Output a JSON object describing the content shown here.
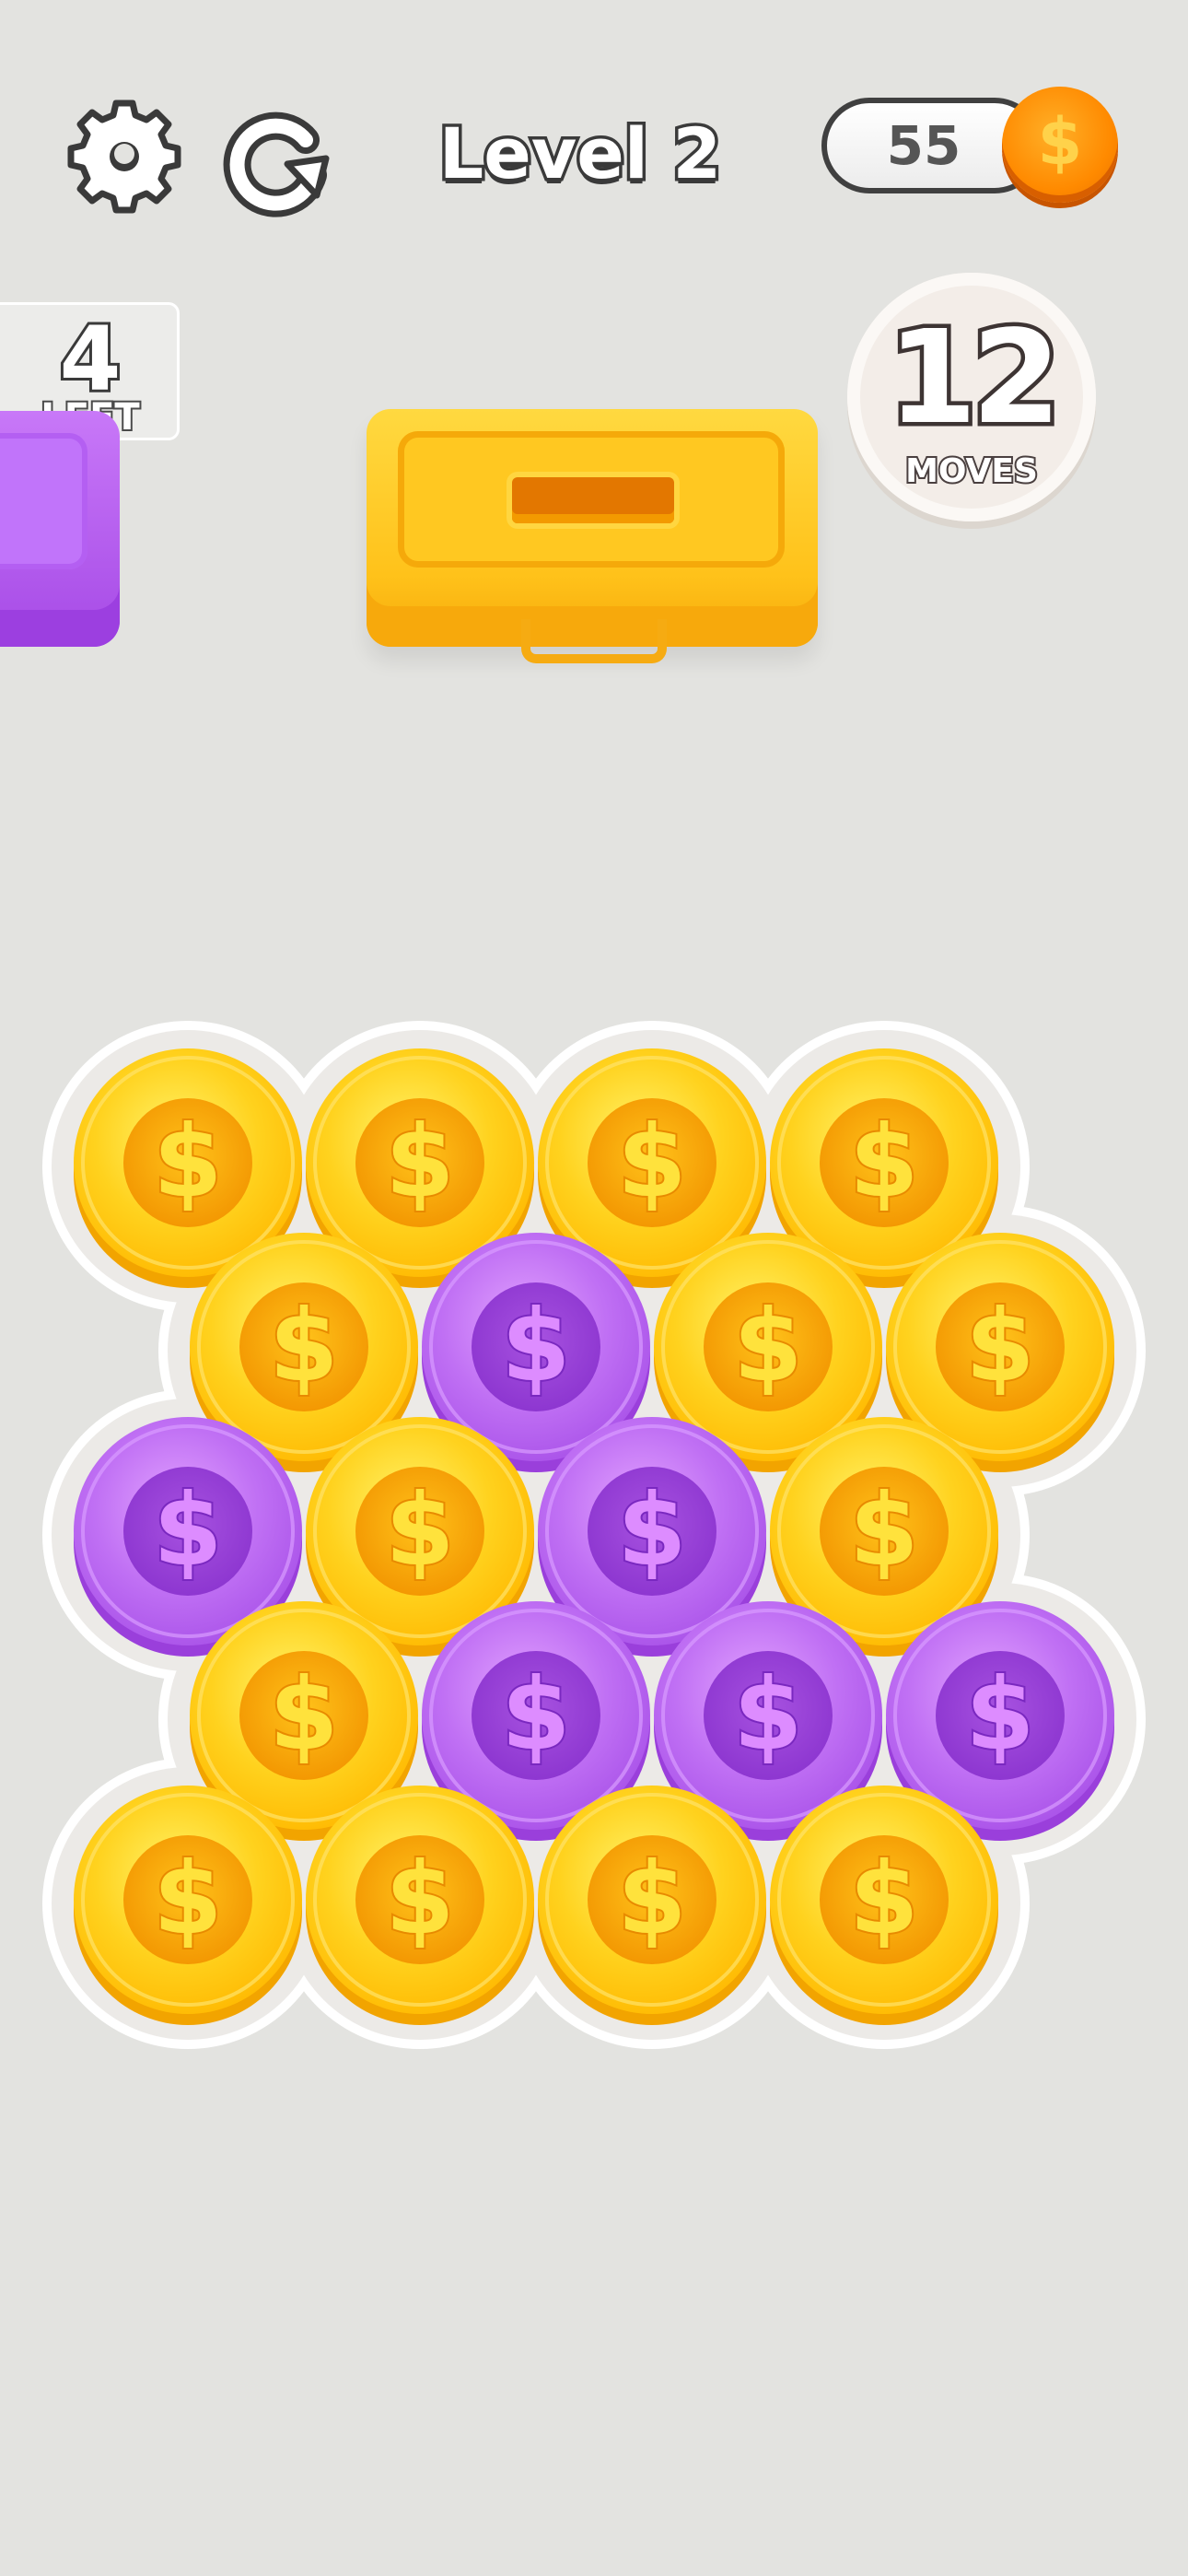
{
  "header": {
    "settings_icon": "gear-icon",
    "restart_icon": "restart-icon",
    "level_title": "Level 2",
    "coins": "55",
    "coin_symbol": "$"
  },
  "remaining": {
    "count": "4",
    "label": "LEFT"
  },
  "moves": {
    "count": "12",
    "label": "MOVES"
  },
  "boxes": [
    {
      "color": "purple",
      "state": "partially visible"
    },
    {
      "color": "yellow",
      "state": "active"
    }
  ],
  "colors": {
    "background": "#e3e3e0",
    "gold": "#ffc21a",
    "purple": "#a64ae6",
    "accent_orange": "#ff8a00"
  },
  "board": {
    "coin_symbol": "$",
    "rows": [
      [
        "gold",
        "gold",
        "gold",
        "gold"
      ],
      [
        "gold",
        "purple",
        "gold",
        "gold"
      ],
      [
        "purple",
        "gold",
        "purple",
        "gold"
      ],
      [
        "gold",
        "purple",
        "purple",
        "purple"
      ],
      [
        "gold",
        "gold",
        "gold",
        "gold"
      ]
    ]
  }
}
